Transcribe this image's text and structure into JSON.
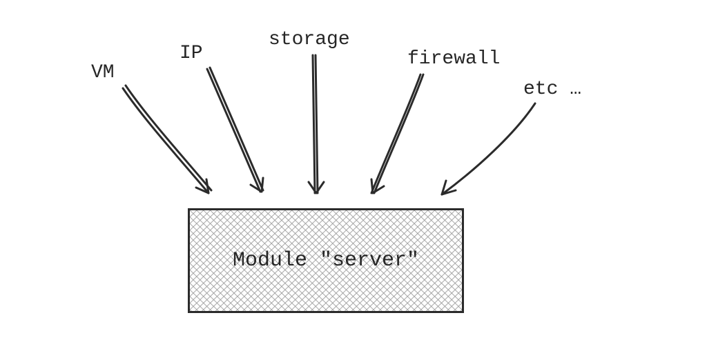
{
  "inputs": {
    "vm": "VM",
    "ip": "IP",
    "storage": "storage",
    "firewall": "firewall",
    "etc": "etc …"
  },
  "module": {
    "label": "Module \"server\""
  }
}
